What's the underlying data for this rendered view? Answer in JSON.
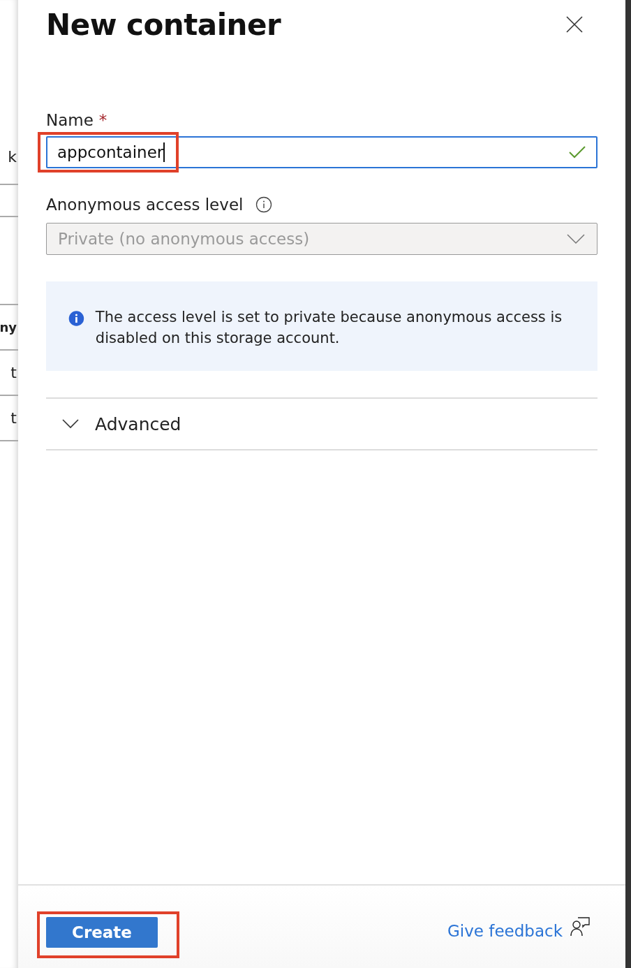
{
  "background_page": {
    "fragments": [
      {
        "text": "k",
        "bold": false
      },
      {
        "text": "ny",
        "bold": true
      },
      {
        "text": "t",
        "bold": false
      },
      {
        "text": "t",
        "bold": false
      }
    ]
  },
  "panel": {
    "title": "New container",
    "name_field": {
      "label": "Name",
      "required_mark": "*",
      "value": "appcontainer",
      "valid": true,
      "highlighted": true
    },
    "access_field": {
      "label": "Anonymous access level",
      "value": "Private (no anonymous access)",
      "disabled": true
    },
    "info_message": "The access level is set to private because anonymous access is disabled on this storage account.",
    "advanced": {
      "label": "Advanced",
      "expanded": false
    },
    "footer": {
      "create_button": {
        "label": "Create",
        "highlighted": true
      },
      "feedback_link": "Give feedback"
    }
  }
}
